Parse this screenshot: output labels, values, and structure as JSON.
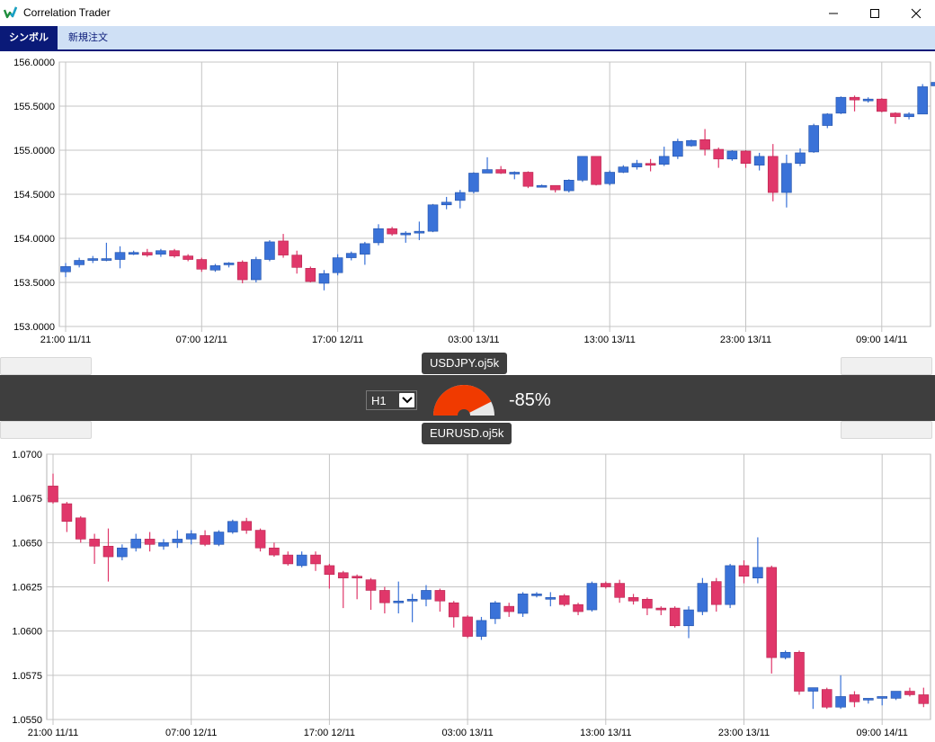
{
  "window": {
    "title": "Correlation Trader"
  },
  "tabs": [
    {
      "label": "シンボル"
    },
    {
      "label": "新規注文"
    }
  ],
  "correlation": {
    "timeframe": "H1",
    "value_text": "-85%",
    "value": -0.85,
    "symbol_top": "USDJPY.oj5k",
    "symbol_bottom": "EURUSD.oj5k"
  },
  "colors": {
    "bull": "#3a72d8",
    "bear": "#e0376a",
    "gauge_fill": "#f03a00",
    "accent": "#0a1a78"
  },
  "chart_data": [
    {
      "type": "candlestick",
      "symbol": "USDJPY.oj5k",
      "ylim": [
        153.0,
        156.0
      ],
      "y_ticks": [
        "153.0000",
        "153.5000",
        "154.0000",
        "154.5000",
        "155.0000",
        "155.5000",
        "156.0000"
      ],
      "x_ticks": [
        "21:00 11/11",
        "07:00 12/11",
        "17:00 12/11",
        "03:00 13/11",
        "13:00 13/11",
        "23:00 13/11",
        "09:00 14/11"
      ],
      "candles": [
        [
          153.62,
          153.68,
          153.56,
          153.72
        ],
        [
          153.7,
          153.75,
          153.67,
          153.78
        ],
        [
          153.76,
          153.77,
          153.72,
          153.8
        ],
        [
          153.77,
          153.77,
          153.74,
          153.95
        ],
        [
          153.76,
          153.84,
          153.66,
          153.91
        ],
        [
          153.83,
          153.84,
          153.81,
          153.86
        ],
        [
          153.84,
          153.81,
          153.79,
          153.88
        ],
        [
          153.82,
          153.86,
          153.79,
          153.88
        ],
        [
          153.86,
          153.8,
          153.78,
          153.88
        ],
        [
          153.8,
          153.76,
          153.74,
          153.82
        ],
        [
          153.76,
          153.65,
          153.62,
          153.78
        ],
        [
          153.64,
          153.69,
          153.62,
          153.71
        ],
        [
          153.7,
          153.72,
          153.67,
          153.73
        ],
        [
          153.73,
          153.53,
          153.49,
          153.75
        ],
        [
          153.53,
          153.76,
          153.5,
          153.79
        ],
        [
          153.76,
          153.96,
          153.74,
          153.98
        ],
        [
          153.97,
          153.81,
          153.78,
          154.05
        ],
        [
          153.81,
          153.67,
          153.6,
          153.86
        ],
        [
          153.66,
          153.51,
          153.5,
          153.68
        ],
        [
          153.49,
          153.6,
          153.41,
          153.64
        ],
        [
          153.61,
          153.78,
          153.58,
          153.82
        ],
        [
          153.78,
          153.83,
          153.75,
          153.85
        ],
        [
          153.82,
          153.94,
          153.7,
          153.96
        ],
        [
          153.95,
          154.11,
          153.92,
          154.16
        ],
        [
          154.11,
          154.05,
          154.03,
          154.13
        ],
        [
          154.04,
          154.06,
          153.95,
          154.08
        ],
        [
          154.06,
          154.08,
          153.98,
          154.19
        ],
        [
          154.08,
          154.38,
          154.07,
          154.39
        ],
        [
          154.38,
          154.41,
          154.33,
          154.47
        ],
        [
          154.43,
          154.52,
          154.34,
          154.55
        ],
        [
          154.53,
          154.74,
          154.51,
          154.75
        ],
        [
          154.74,
          154.78,
          154.74,
          154.92
        ],
        [
          154.78,
          154.74,
          154.73,
          154.82
        ],
        [
          154.74,
          154.75,
          154.67,
          154.76
        ],
        [
          154.75,
          154.59,
          154.57,
          154.76
        ],
        [
          154.58,
          154.6,
          154.58,
          154.61
        ],
        [
          154.6,
          154.55,
          154.52,
          154.6
        ],
        [
          154.54,
          154.66,
          154.52,
          154.67
        ],
        [
          154.66,
          154.93,
          154.64,
          154.93
        ],
        [
          154.93,
          154.61,
          154.6,
          154.93
        ],
        [
          154.62,
          154.75,
          154.6,
          154.77
        ],
        [
          154.75,
          154.81,
          154.74,
          154.83
        ],
        [
          154.81,
          154.85,
          154.78,
          154.89
        ],
        [
          154.85,
          154.83,
          154.76,
          154.9
        ],
        [
          154.84,
          154.93,
          154.82,
          155.04
        ],
        [
          154.93,
          155.1,
          154.9,
          155.13
        ],
        [
          155.05,
          155.11,
          155.04,
          155.12
        ],
        [
          155.12,
          155.01,
          154.94,
          155.24
        ],
        [
          155.01,
          154.9,
          154.8,
          155.03
        ],
        [
          154.9,
          154.99,
          154.88,
          155.0
        ],
        [
          154.99,
          154.85,
          154.8,
          155.0
        ],
        [
          154.83,
          154.93,
          154.77,
          154.97
        ],
        [
          154.93,
          154.52,
          154.42,
          155.07
        ],
        [
          154.52,
          154.85,
          154.35,
          154.95
        ],
        [
          154.85,
          154.97,
          154.82,
          155.02
        ],
        [
          154.98,
          155.28,
          154.97,
          155.3
        ],
        [
          155.28,
          155.41,
          155.25,
          155.42
        ],
        [
          155.42,
          155.6,
          155.41,
          155.61
        ],
        [
          155.6,
          155.57,
          155.44,
          155.62
        ],
        [
          155.57,
          155.58,
          155.54,
          155.6
        ],
        [
          155.58,
          155.44,
          155.43,
          155.59
        ],
        [
          155.42,
          155.38,
          155.3,
          155.43
        ],
        [
          155.38,
          155.41,
          155.35,
          155.43
        ],
        [
          155.41,
          155.72,
          155.41,
          155.75
        ],
        [
          155.73,
          155.77,
          155.71,
          155.79
        ]
      ]
    },
    {
      "type": "candlestick",
      "symbol": "EURUSD.oj5k",
      "ylim": [
        1.055,
        1.07
      ],
      "y_ticks": [
        "1.0550",
        "1.0575",
        "1.0600",
        "1.0625",
        "1.0650",
        "1.0675",
        "1.0700"
      ],
      "x_ticks": [
        "21:00 11/11",
        "07:00 12/11",
        "17:00 12/11",
        "03:00 13/11",
        "13:00 13/11",
        "23:00 13/11",
        "09:00 14/11"
      ],
      "candles": [
        [
          1.0682,
          1.0673,
          1.0672,
          1.0689
        ],
        [
          1.0672,
          1.0662,
          1.0656,
          1.0673
        ],
        [
          1.0664,
          1.0652,
          1.065,
          1.0665
        ],
        [
          1.0652,
          1.0648,
          1.0638,
          1.0655
        ],
        [
          1.0648,
          1.0642,
          1.0628,
          1.0658
        ],
        [
          1.0642,
          1.0647,
          1.064,
          1.0649
        ],
        [
          1.0647,
          1.0652,
          1.0645,
          1.0655
        ],
        [
          1.0652,
          1.0649,
          1.0645,
          1.0656
        ],
        [
          1.0648,
          1.065,
          1.0646,
          1.0652
        ],
        [
          1.065,
          1.0652,
          1.0647,
          1.0657
        ],
        [
          1.0652,
          1.0655,
          1.0649,
          1.0657
        ],
        [
          1.0654,
          1.0649,
          1.0648,
          1.0657
        ],
        [
          1.0649,
          1.0656,
          1.0648,
          1.0657
        ],
        [
          1.0656,
          1.0662,
          1.0655,
          1.0663
        ],
        [
          1.0662,
          1.0657,
          1.0655,
          1.0664
        ],
        [
          1.0657,
          1.0647,
          1.0645,
          1.0658
        ],
        [
          1.0647,
          1.0643,
          1.0642,
          1.065
        ],
        [
          1.0643,
          1.0638,
          1.0637,
          1.0645
        ],
        [
          1.0637,
          1.0643,
          1.0636,
          1.0645
        ],
        [
          1.0643,
          1.0638,
          1.0634,
          1.0645
        ],
        [
          1.0637,
          1.0632,
          1.0624,
          1.0638
        ],
        [
          1.0633,
          1.063,
          1.0613,
          1.0634
        ],
        [
          1.0631,
          1.063,
          1.0618,
          1.0632
        ],
        [
          1.0629,
          1.0623,
          1.0612,
          1.063
        ],
        [
          1.0623,
          1.0616,
          1.061,
          1.0625
        ],
        [
          1.0617,
          1.0617,
          1.061,
          1.0628
        ],
        [
          1.0617,
          1.0618,
          1.0605,
          1.0621
        ],
        [
          1.0618,
          1.0623,
          1.0614,
          1.0626
        ],
        [
          1.0623,
          1.0617,
          1.0611,
          1.0624
        ],
        [
          1.0616,
          1.0608,
          1.0602,
          1.0617
        ],
        [
          1.0608,
          1.0597,
          1.0596,
          1.0609
        ],
        [
          1.0597,
          1.0606,
          1.0595,
          1.0608
        ],
        [
          1.0607,
          1.0616,
          1.0604,
          1.0617
        ],
        [
          1.0614,
          1.0611,
          1.0608,
          1.0616
        ],
        [
          1.061,
          1.0621,
          1.0608,
          1.0622
        ],
        [
          1.062,
          1.0621,
          1.0619,
          1.0622
        ],
        [
          1.0619,
          1.0619,
          1.0614,
          1.0622
        ],
        [
          1.062,
          1.0615,
          1.0614,
          1.0621
        ],
        [
          1.0615,
          1.0611,
          1.0609,
          1.0616
        ],
        [
          1.0612,
          1.0627,
          1.0611,
          1.0628
        ],
        [
          1.0627,
          1.0625,
          1.0624,
          1.0628
        ],
        [
          1.0627,
          1.0619,
          1.0616,
          1.0629
        ],
        [
          1.0619,
          1.0617,
          1.0615,
          1.0621
        ],
        [
          1.0618,
          1.0613,
          1.0609,
          1.0619
        ],
        [
          1.0613,
          1.0612,
          1.0609,
          1.0614
        ],
        [
          1.0613,
          1.0603,
          1.0602,
          1.0614
        ],
        [
          1.0603,
          1.0612,
          1.0596,
          1.0614
        ],
        [
          1.0611,
          1.0627,
          1.0609,
          1.063
        ],
        [
          1.0628,
          1.0615,
          1.0611,
          1.063
        ],
        [
          1.0615,
          1.0637,
          1.0613,
          1.0638
        ],
        [
          1.0637,
          1.0631,
          1.0627,
          1.064
        ],
        [
          1.063,
          1.0636,
          1.0627,
          1.0653
        ],
        [
          1.0636,
          1.0585,
          1.0576,
          1.0637
        ],
        [
          1.0585,
          1.0588,
          1.0584,
          1.0589
        ],
        [
          1.0588,
          1.0566,
          1.0564,
          1.0589
        ],
        [
          1.0566,
          1.0568,
          1.0556,
          1.0568
        ],
        [
          1.0567,
          1.0557,
          1.0556,
          1.0568
        ],
        [
          1.0557,
          1.0563,
          1.0556,
          1.0575
        ],
        [
          1.0564,
          1.056,
          1.0557,
          1.0566
        ],
        [
          1.0561,
          1.0562,
          1.0559,
          1.0562
        ],
        [
          1.0562,
          1.0563,
          1.0558,
          1.0563
        ],
        [
          1.0562,
          1.0566,
          1.0561,
          1.0566
        ],
        [
          1.0566,
          1.0564,
          1.0563,
          1.0568
        ],
        [
          1.0564,
          1.0559,
          1.0557,
          1.0568
        ]
      ]
    }
  ]
}
